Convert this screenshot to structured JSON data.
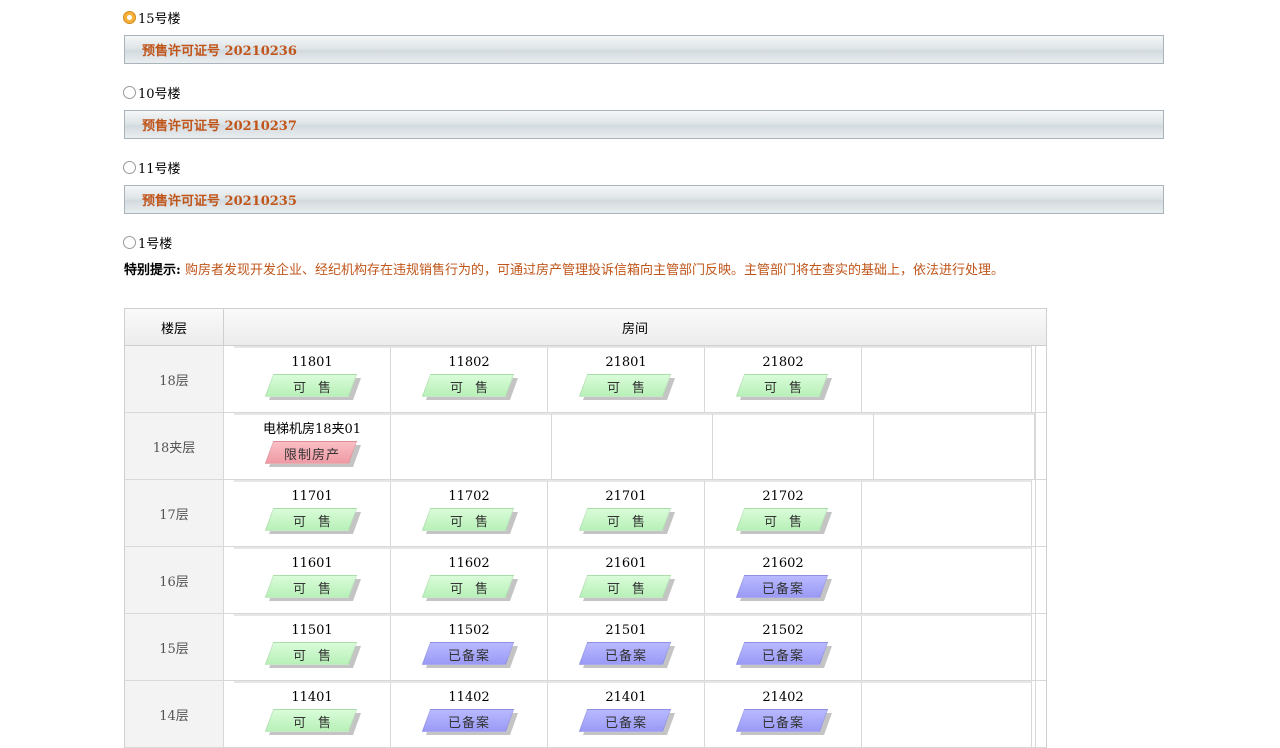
{
  "buildings": [
    {
      "label": "15号楼",
      "selected": true,
      "permit": "预售许可证号 20210236"
    },
    {
      "label": "10号楼",
      "selected": false,
      "permit": "预售许可证号 20210237"
    },
    {
      "label": "11号楼",
      "selected": false,
      "permit": "预售许可证号 20210235"
    },
    {
      "label": "1号楼",
      "selected": false
    }
  ],
  "notice": {
    "label": "特别提示:",
    "text": "购房者发现开发企业、经纪机构存在违规销售行为的，可通过房产管理投诉信箱向主管部门反映。主管部门将在查实的基础上，依法进行处理。"
  },
  "table": {
    "header_floor": "楼层",
    "header_room": "房间",
    "rows": [
      {
        "floor": "18层",
        "rooms": [
          {
            "number": "11801",
            "status": "可售",
            "status_type": "available"
          },
          {
            "number": "11802",
            "status": "可售",
            "status_type": "available"
          },
          {
            "number": "21801",
            "status": "可售",
            "status_type": "available"
          },
          {
            "number": "21802",
            "status": "可售",
            "status_type": "available"
          }
        ]
      },
      {
        "floor": "18夹层",
        "rooms": [
          {
            "number": "电梯机房18夹01",
            "status": "限制房产",
            "status_type": "restricted"
          }
        ]
      },
      {
        "floor": "17层",
        "rooms": [
          {
            "number": "11701",
            "status": "可售",
            "status_type": "available"
          },
          {
            "number": "11702",
            "status": "可售",
            "status_type": "available"
          },
          {
            "number": "21701",
            "status": "可售",
            "status_type": "available"
          },
          {
            "number": "21702",
            "status": "可售",
            "status_type": "available"
          }
        ]
      },
      {
        "floor": "16层",
        "rooms": [
          {
            "number": "11601",
            "status": "可售",
            "status_type": "available"
          },
          {
            "number": "11602",
            "status": "可售",
            "status_type": "available"
          },
          {
            "number": "21601",
            "status": "可售",
            "status_type": "available"
          },
          {
            "number": "21602",
            "status": "已备案",
            "status_type": "filed"
          }
        ]
      },
      {
        "floor": "15层",
        "rooms": [
          {
            "number": "11501",
            "status": "可售",
            "status_type": "available"
          },
          {
            "number": "11502",
            "status": "已备案",
            "status_type": "filed"
          },
          {
            "number": "21501",
            "status": "已备案",
            "status_type": "filed"
          },
          {
            "number": "21502",
            "status": "已备案",
            "status_type": "filed"
          }
        ]
      },
      {
        "floor": "14层",
        "rooms": [
          {
            "number": "11401",
            "status": "可售",
            "status_type": "available"
          },
          {
            "number": "11402",
            "status": "已备案",
            "status_type": "filed"
          },
          {
            "number": "21401",
            "status": "已备案",
            "status_type": "filed"
          },
          {
            "number": "21402",
            "status": "已备案",
            "status_type": "filed"
          }
        ]
      }
    ]
  },
  "colors": {
    "available": "#c6f5c6",
    "filed": "#a8a8fa",
    "restricted": "#f3aab2",
    "permit_text": "#c0551a"
  }
}
